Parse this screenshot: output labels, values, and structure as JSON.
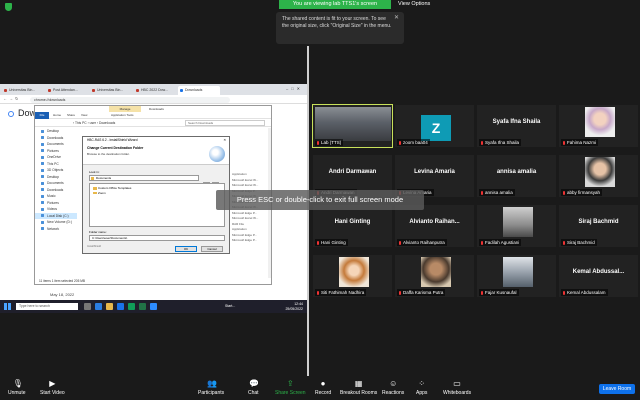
{
  "top": {
    "viewing_text": "You are viewing lab TTS1's screen",
    "view_options": "View Options",
    "tooltip": "The shared content is fit to your screen. To see the original size, click \"Original Size\" in the menu."
  },
  "shared": {
    "browser_tabs": [
      "Universitas Bin...",
      "Post Attendan...",
      "Universitas Bin...",
      "HBC 2022 Dow...",
      "Downloads"
    ],
    "address": "chrome://downloads",
    "page_title": "Downl",
    "explorer": {
      "manage": "Manage",
      "downloads_title": "Downloads",
      "ribbon": [
        "File",
        "Home",
        "Share",
        "View",
        "Application Tools"
      ],
      "crumb": "› This PC › user › Downloads",
      "search": "Search Downloads",
      "sidebar": [
        "Desktop",
        "Downloads",
        "Documents",
        "Pictures",
        "OneDrive",
        "This PC",
        "3D Objects",
        "Desktop",
        "Documents",
        "Downloads",
        "Music",
        "Pictures",
        "Videos",
        "Local Disk (C:)",
        "New Volume (D:)",
        "Network"
      ],
      "files": [
        "Today",
        "Last week",
        "Earlier this month",
        "Last month (2)"
      ],
      "recent": [
        "Namadi_Akhir_Kelas...",
        "Metode-Mock"
      ],
      "pane": [
        "Application",
        "Microsoft Excel W...",
        "Microsoft Excel W...",
        "Microsoft Edge P...",
        "Microsoft Excel W...",
        "Microsoft Excel W...",
        "Microsoft Excel W...",
        "Microsoft Edge P...",
        "Microsoft Excel W...",
        "RAR File",
        "Application",
        "Microsoft Edge P...",
        "Microsoft Edge P..."
      ],
      "status": "11 items   1 item selected  205 MB",
      "dates": [
        "12/05/2022 12:20",
        "11/05/2022 9:31"
      ]
    },
    "dialog": {
      "title": "HBC-RAS 6.2 - InstallShield Wizard",
      "heading": "Change Current Destination Folder",
      "sub": "Browse to the destination folder.",
      "look_in_label": "Look in:",
      "look_in": "Documents",
      "folders": [
        "Custom Office Templates",
        "Zoom"
      ],
      "folder_name_label": "Folder name:",
      "folder_name": "C:\\Users\\user\\Documents\\",
      "installshield": "InstallShield",
      "ok": "OK",
      "cancel": "Cancel"
    },
    "date": "May 18, 2022",
    "taskbar": {
      "search": "Type here to search",
      "start": "Start...",
      "time": "12:44",
      "date": "25/05/2022"
    }
  },
  "participants": [
    {
      "label": "Lab (TTS)",
      "name": "",
      "kind": "video"
    },
    {
      "label": "zoom baa04",
      "name": "",
      "kind": "avatar",
      "initial": "Z"
    },
    {
      "label": "Syafa Ifna Shaila",
      "name": "Syafa Ifna Shaila",
      "kind": "name"
    },
    {
      "label": "Fahima Nazmi",
      "name": "",
      "kind": "photo"
    },
    {
      "label": "Andri Darmawan",
      "name": "Andri Darmawan",
      "kind": "name"
    },
    {
      "label": "Levina Amaria",
      "name": "Levina Amaria",
      "kind": "name"
    },
    {
      "label": "annisa amalia",
      "name": "annisa amalia",
      "kind": "name"
    },
    {
      "label": "abby firmansyah",
      "name": "",
      "kind": "photo"
    },
    {
      "label": "Hani Ginting",
      "name": "Hani Ginting",
      "kind": "name"
    },
    {
      "label": "Alvianto Raihanputra",
      "name": "Alvianto Raihan...",
      "kind": "name"
    },
    {
      "label": "Fadilah Agustiani",
      "name": "",
      "kind": "photo"
    },
    {
      "label": "Siraj Bachmid",
      "name": "Siraj Bachmid",
      "kind": "name"
    },
    {
      "label": "Siti Fathimah Nadhira",
      "name": "",
      "kind": "photo"
    },
    {
      "label": "Daffa Karisma Putra",
      "name": "",
      "kind": "photo"
    },
    {
      "label": "Fajar Kusnaufal",
      "name": "",
      "kind": "photo"
    },
    {
      "label": "Kemal Abdussalam",
      "name": "Kemal Abdussal...",
      "kind": "name"
    }
  ],
  "esc_message": "Press ESC or double-click to exit full screen mode",
  "toolbar": {
    "unmute": "Unmute",
    "start_video": "Start Video",
    "participants": "Participants",
    "participants_count": "20",
    "chat": "Chat",
    "share_screen": "Share Screen",
    "record": "Record",
    "breakout": "Breakout Rooms",
    "reactions": "Reactions",
    "apps": "Apps",
    "whiteboards": "Whiteboards",
    "leave": "Leave Room"
  },
  "colors": {
    "green": "#2db34a",
    "leave_blue": "#0e71eb",
    "speaker_border": "#c8e15a"
  }
}
